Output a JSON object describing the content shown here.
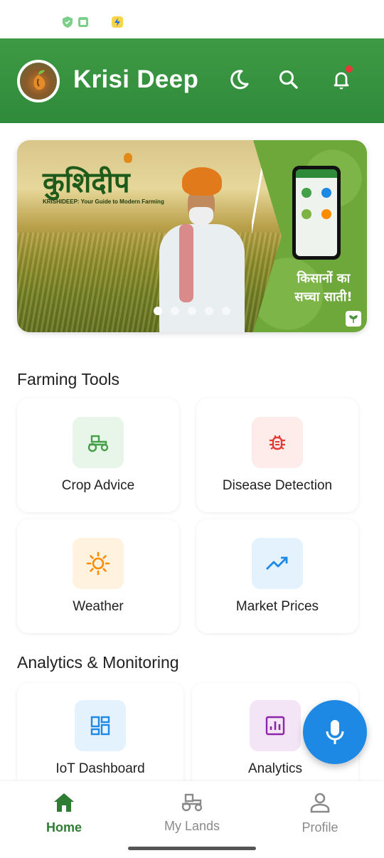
{
  "app": {
    "title": "Krisi Deep"
  },
  "banner": {
    "brand_hindi": "कुशिदीप",
    "brand_sub": "KRISHIDEEP: Your Guide to Modern Farming",
    "slogan_line1": "किसानों का",
    "slogan_line2": "सच्चा साती!",
    "slides": 5,
    "active_slide": 1
  },
  "sections": {
    "farming_tools": "Farming Tools",
    "analytics": "Analytics & Monitoring"
  },
  "tools": [
    {
      "label": "Crop Advice",
      "icon": "tractor-icon",
      "tile_color": "#e8f5e9",
      "icon_color": "#43a047"
    },
    {
      "label": "Disease Detection",
      "icon": "bug-icon",
      "tile_color": "#fdecea",
      "icon_color": "#e53935"
    },
    {
      "label": "Weather",
      "icon": "sun-icon",
      "tile_color": "#fff3e0",
      "icon_color": "#fb8c00"
    },
    {
      "label": "Market Prices",
      "icon": "trending-up-icon",
      "tile_color": "#e3f2fd",
      "icon_color": "#1e88e5"
    }
  ],
  "analytics_cards": [
    {
      "label": "IoT Dashboard",
      "icon": "dashboard-icon",
      "tile_color": "#e3f2fd",
      "icon_color": "#1e88e5"
    },
    {
      "label": "Analytics",
      "icon": "analytics-icon",
      "tile_color": "#f3e5f5",
      "icon_color": "#8e24aa"
    }
  ],
  "nav": [
    {
      "label": "Home",
      "icon": "home-icon",
      "active": true
    },
    {
      "label": "My Lands",
      "icon": "tractor-icon",
      "active": false
    },
    {
      "label": "Profile",
      "icon": "person-icon",
      "active": false
    }
  ],
  "colors": {
    "primary": "#2e8b3a",
    "fab": "#1e88e5",
    "notification_dot": "#e53935"
  }
}
